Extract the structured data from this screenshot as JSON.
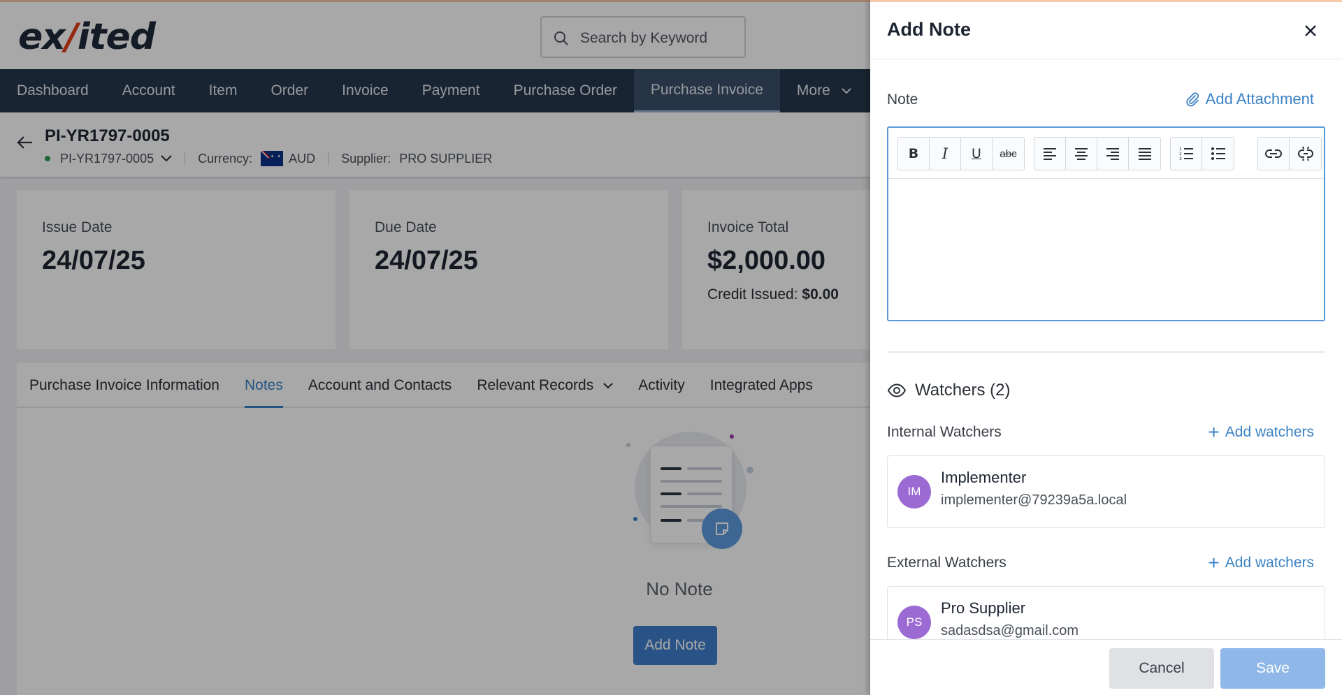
{
  "app": {
    "logo_left": "ex",
    "logo_slash": "/",
    "logo_right": "ited",
    "search_placeholder": "Search by Keyword"
  },
  "nav": {
    "items": [
      "Dashboard",
      "Account",
      "Item",
      "Order",
      "Invoice",
      "Payment",
      "Purchase Order",
      "Purchase Invoice"
    ],
    "active": "Purchase Invoice",
    "more_label": "More"
  },
  "record": {
    "title": "PI-YR1797-0005",
    "id": "PI-YR1797-0005",
    "currency_label": "Currency:",
    "currency": "AUD",
    "supplier_label": "Supplier:",
    "supplier": "PRO SUPPLIER"
  },
  "cards": {
    "issue": {
      "label": "Issue Date",
      "value": "24/07/25"
    },
    "due": {
      "label": "Due Date",
      "value": "24/07/25"
    },
    "total": {
      "label": "Invoice Total",
      "value": "$2,000.00",
      "credit_label": "Credit Issued:",
      "credit_value": "$0.00"
    }
  },
  "tabs": {
    "items": [
      "Purchase Invoice Information",
      "Notes",
      "Account and Contacts",
      "Relevant Records",
      "Activity",
      "Integrated Apps"
    ],
    "active": "Notes"
  },
  "notes": {
    "empty_text": "No Note",
    "add_button": "Add Note"
  },
  "drawer": {
    "title": "Add Note",
    "note_label": "Note",
    "attachment_label": "Add Attachment",
    "toolbar": {
      "bold": "B",
      "italic": "I",
      "underline": "U",
      "strike": "abc"
    },
    "watchers_title": "Watchers (2)",
    "internal": {
      "label": "Internal Watchers",
      "add_label": "Add watchers",
      "initials": "IM",
      "name": "Implementer",
      "email": "implementer@79239a5a.local"
    },
    "external": {
      "label": "External Watchers",
      "add_label": "Add watchers",
      "initials": "PS",
      "name": "Pro Supplier",
      "email": "sadasdsa@gmail.com"
    },
    "cancel_label": "Cancel",
    "save_label": "Save"
  },
  "colors": {
    "accent": "#3b82c4",
    "nav_bg": "#27374d",
    "avatar": "#9b6bd3",
    "save_disabled": "#8fb7e8"
  }
}
